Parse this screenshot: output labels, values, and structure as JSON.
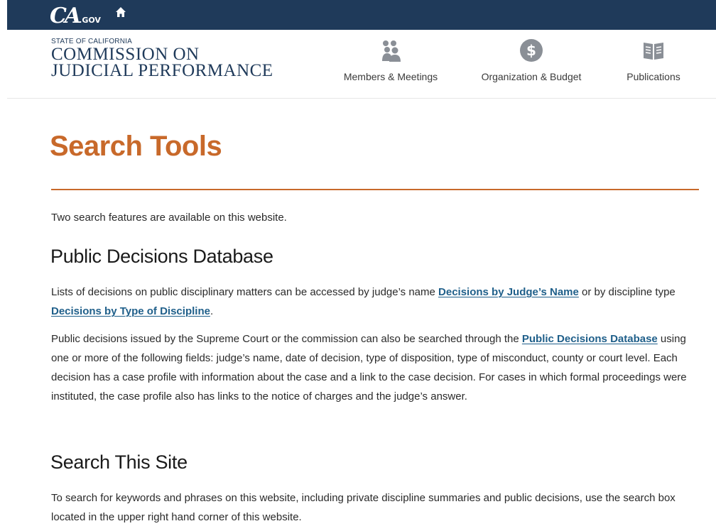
{
  "top_bar": {
    "logo_ca": "CA",
    "logo_gov": ".GOV",
    "home_icon": "home-icon"
  },
  "header": {
    "state_label": "STATE OF CALIFORNIA",
    "agency_line1": "COMMISSION ON",
    "agency_line2": "JUDICIAL PERFORMANCE",
    "nav": [
      {
        "label": "Members & Meetings",
        "icon": "people-icon"
      },
      {
        "label": "Organization & Budget",
        "icon": "dollar-icon"
      },
      {
        "label": "Publications",
        "icon": "book-icon"
      }
    ]
  },
  "main": {
    "title": "Search Tools",
    "intro": "Two search features are available on this website.",
    "public_heading": "Public Decisions Database",
    "p1_text1": "Lists of decisions on public disciplinary matters can be accessed by judge’s name ",
    "p1_link1": "Decisions by Judge’s Name",
    "p1_text2": " or by discipline type ",
    "p1_link2": "Decisions by Type of Discipline",
    "p1_text3": ".",
    "p2_text1": "Public decisions issued by the Supreme Court or the commission can also be searched through the ",
    "p2_link": "Public Decisions Database",
    "p2_text2": " using one or more of the following fields: judge’s name, date of decision, type of disposition, type of misconduct, county or court level.  Each decision has a case profile with information about the case and a link to the case decision.  For cases in which formal proceedings were instituted, the case profile also has links to the notice of charges and the judge’s answer.",
    "search_heading": "Search This Site",
    "p3_text": "To search for keywords and phrases on this website, including private discipline summaries and public decisions, use the search box located in the upper right hand corner of this website."
  },
  "colors": {
    "top_bar": "#1f3a5a",
    "accent": "#c8692a",
    "link": "#1f5f8a"
  }
}
